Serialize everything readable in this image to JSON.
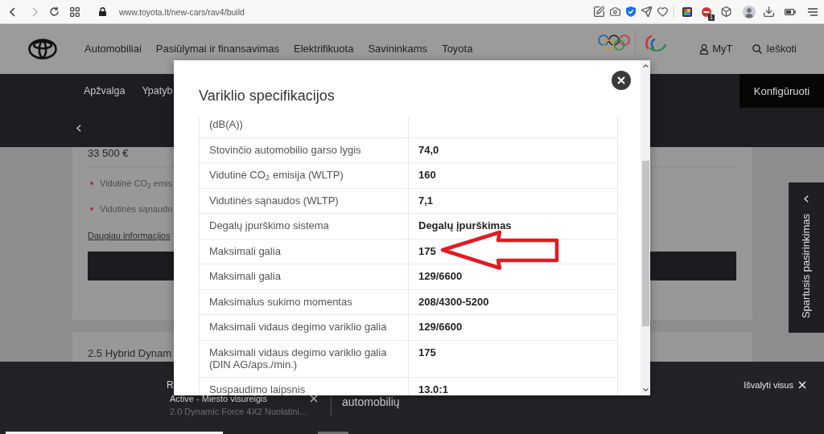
{
  "browser": {
    "url": "www.toyota.lt/new-cars/rav4/build",
    "extension_badge": "1"
  },
  "header": {
    "nav": [
      "Automobiliai",
      "Pasiūlymai ir finansavimas",
      "Elektrifikuota",
      "Savininkams",
      "Toyota"
    ],
    "account": "MyT",
    "search": "Ieškoti"
  },
  "subnav": {
    "tabs": [
      "Apžvalga",
      "Ypatyb"
    ],
    "configure_button": "Konfigūruoti"
  },
  "offer_card": {
    "price": "33 500 €",
    "bullets": [
      "Vidutinė CO$_{2}$ emis",
      "Vidutinės sąnaudo"
    ],
    "link": "Daugiau informacijos"
  },
  "next_card": {
    "title": "2.5 Hybrid Dynam"
  },
  "side_tab": {
    "label": "Spartusis pasirinkimas"
  },
  "bottom_bar": {
    "heading": "R",
    "filter": "Active - Miesto visureigis",
    "filter_detail": "2.0 Dynamic Force 4X2 Nuolatini…",
    "count_label": "automobilių",
    "clear_all": "Išvalyti visus"
  },
  "modal": {
    "title": "Variklio specifikacijos",
    "rows": [
      {
        "label": "(dB(A))"
      },
      {
        "label": "Stovinčio automobilio garso lygis",
        "value": "74,0"
      },
      {
        "label": "Vidutinė CO$_{2}$ emisija (WLTP)",
        "value": "160"
      },
      {
        "label": "Vidutinės sąnaudos (WLTP)",
        "value": "7,1"
      },
      {
        "label": "Degalų įpurškimo sistema",
        "value": "Degalų įpurškimas"
      },
      {
        "label": "Maksimali galia",
        "value": "175"
      },
      {
        "label": "Maksimali galia",
        "value": "129/6600"
      },
      {
        "label": "Maksimalus sukimo momentas",
        "value": "208/4300-5200"
      },
      {
        "label": "Maksimali vidaus degimo variklio galia",
        "value": "129/6600"
      },
      {
        "label": "Maksimali vidaus degimo variklio galia (DIN AG/aps./min.)",
        "value": "175"
      },
      {
        "label": "Suspaudimo laipsnis",
        "value": "13.0:1"
      }
    ]
  }
}
